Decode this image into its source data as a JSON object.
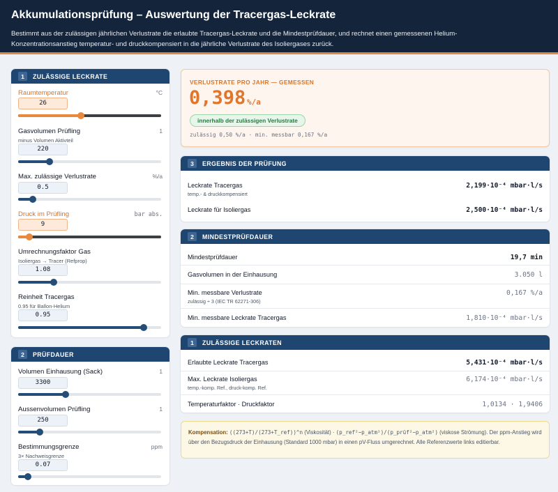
{
  "header": {
    "title": "Akkumulationsprüfung – Auswertung der Tracergas-Leckrate",
    "description": "Bestimmt aus der zulässigen jährlichen Verlustrate die erlaubte Tracergas-Leckrate und die Mindestprüfdauer, und rechnet einen gemessenen Helium-Konzentrationsanstieg temperatur- und druckkompensiert in die jährliche Verlustrate des Isoliergases zurück."
  },
  "panel1": {
    "number": "1",
    "title": "ZULÄSSIGE LECKRATE",
    "fields": [
      {
        "label": "Raumtemperatur",
        "sub": "",
        "unit": "°C",
        "value": "26",
        "level": 0.44,
        "highlight": true
      },
      {
        "label": "Gasvolumen Prüfling",
        "sub": "minus Volumen Aktivteil",
        "unit": "1",
        "value": "220",
        "level": 0.22,
        "highlight": false
      },
      {
        "label": "Max. zulässige Verlustrate",
        "sub": "",
        "unit": "%/a",
        "value": "0.5",
        "level": 0.1,
        "highlight": false
      },
      {
        "label": "Druck im Prüfling",
        "sub": "",
        "unit": "bar abs.",
        "value": "9",
        "level": 0.08,
        "highlight": true
      },
      {
        "label": "Umrechnungsfaktor Gas",
        "sub": "Isoliergas → Tracer (Refprop)",
        "unit": "",
        "value": "1.08",
        "level": 0.25,
        "highlight": false
      },
      {
        "label": "Reinheit Tracergas",
        "sub": "0.95 für Ballon-Helium",
        "unit": "",
        "value": "0.95",
        "level": 0.88,
        "highlight": false
      }
    ]
  },
  "panel2": {
    "number": "2",
    "title": "PRÜFDAUER",
    "fields": [
      {
        "label": "Volumen Einhausung (Sack)",
        "sub": "",
        "unit": "1",
        "value": "3300",
        "level": 0.33,
        "highlight": false
      },
      {
        "label": "Aussenvolumen Prüfling",
        "sub": "",
        "unit": "1",
        "value": "250",
        "level": 0.15,
        "highlight": false
      },
      {
        "label": "Bestimmungsgrenze",
        "sub": "3× Nachweisgrenze",
        "unit": "ppm",
        "value": "0.07",
        "level": 0.07,
        "highlight": false
      }
    ]
  },
  "hero": {
    "label": "VERLUSTRATE PRO JAHR — GEMESSEN",
    "value": "0,398",
    "unit": "%/a",
    "status": "innerhalb der zulässigen Verlustrate",
    "footer": "zulässig 0,50 %/a · min. messbar 0,167 %/a"
  },
  "result3": {
    "number": "3",
    "title": "ERGEBNIS DER PRÜFUNG",
    "rows": [
      {
        "label": "Leckrate Tracergas",
        "sub": "temp.- & druckkompensiert",
        "value": "2,199·10⁻⁴ mbar·l/s"
      },
      {
        "label": "Leckrate für Isoliergas",
        "sub": "",
        "value": "2,500·10⁻⁴ mbar·l/s"
      }
    ]
  },
  "result2": {
    "number": "2",
    "title": "MINDESTPRÜFDAUER",
    "rows": [
      {
        "label": "Mindestprüfdauer",
        "sub": "",
        "value": "19,7 min"
      },
      {
        "label": "Gasvolumen in der Einhausung",
        "sub": "",
        "value": "3.050 l"
      },
      {
        "label": "Min. messbare Verlustrate",
        "sub": "zulässig ÷ 3 (IEC TR 62271-306)",
        "value": "0,167 %/a"
      },
      {
        "label": "Min. messbare Leckrate Tracergas",
        "sub": "",
        "value": "1,810·10⁻⁴ mbar·l/s"
      }
    ]
  },
  "result1": {
    "number": "1",
    "title": "ZULÄSSIGE LECKRATEN",
    "rows": [
      {
        "label": "Erlaubte Leckrate Tracergas",
        "sub": "",
        "value": "5,431·10⁻⁴ mbar·l/s"
      },
      {
        "label": "Max. Leckrate Isoliergas",
        "sub": "temp.-komp. Ref., druck-komp. Ref.",
        "value": "6,174·10⁻⁴ mbar·l/s"
      },
      {
        "label": "Temperaturfaktor · Druckfaktor",
        "sub": "",
        "value": "1,0134 · 1,9406"
      }
    ]
  },
  "note": {
    "title": "Kompensation:",
    "formula1": "((273+T)/(273+T_ref))^n",
    "text1": "(Viskosität) ·",
    "formula2": "(p_ref²−p_atm²)/(p_prüf²−p_atm²)",
    "text2": "(viskose Strömung). Der ppm-Anstieg wird über den Bezugsdruck der Einhausung (Standard 1000 mbar) in einen pV-Fluss umgerechnet. Alle Referenzwerte links editierbar."
  },
  "colors": {
    "header_bg": "#14253b",
    "accent_orange": "#e0762c",
    "panel_header": "#1f4670",
    "ok_green": "#2c7a40"
  }
}
